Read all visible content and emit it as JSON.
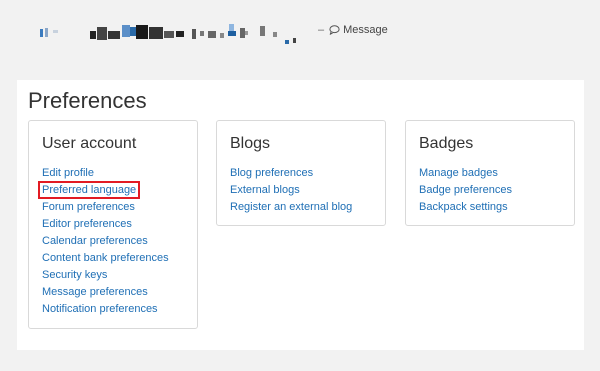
{
  "header": {
    "message_label": "Message",
    "message_icon": "chat-bubble-icon"
  },
  "page": {
    "title": "Preferences"
  },
  "cards": {
    "user_account": {
      "title": "User account",
      "links": [
        "Edit profile",
        "Preferred language",
        "Forum preferences",
        "Editor preferences",
        "Calendar preferences",
        "Content bank preferences",
        "Security keys",
        "Message preferences",
        "Notification preferences"
      ],
      "highlighted_link": "Preferred language"
    },
    "blogs": {
      "title": "Blogs",
      "links": [
        "Blog preferences",
        "External blogs",
        "Register an external blog"
      ]
    },
    "badges": {
      "title": "Badges",
      "links": [
        "Manage badges",
        "Badge preferences",
        "Backpack settings"
      ]
    }
  },
  "colors": {
    "link": "#1f6fb5",
    "highlight_border": "#e21b23",
    "page_background": "#f2f2f2",
    "panel_background": "#ffffff",
    "card_border": "#d9d9d9"
  }
}
